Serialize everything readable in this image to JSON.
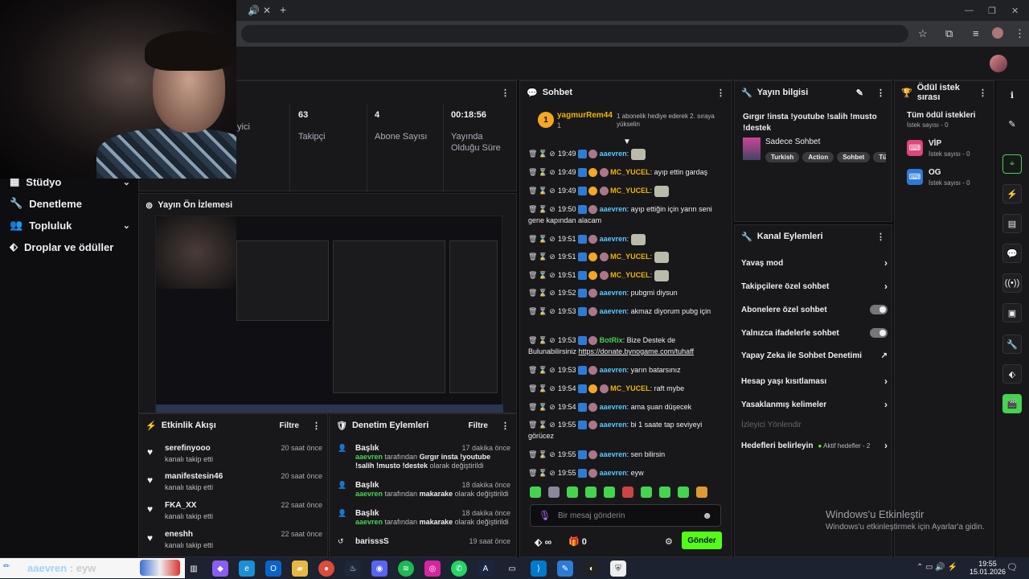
{
  "browser": {
    "tab_mute_icon": "speaker-icon",
    "tab_close": "✕",
    "new_tab": "+"
  },
  "sidebar": {
    "items": [
      {
        "label": "Stüdyo",
        "icon": "studio-icon",
        "chevron": true
      },
      {
        "label": "Denetleme",
        "icon": "wrench-icon",
        "chevron": false
      },
      {
        "label": "Topluluk",
        "icon": "community-icon",
        "chevron": true
      },
      {
        "label": "Droplar ve ödüller",
        "icon": "drops-icon",
        "chevron": false
      }
    ]
  },
  "stats": {
    "partial_label": "yici",
    "items": [
      {
        "value": "63",
        "label": "Takipçi"
      },
      {
        "value": "4",
        "label": "Abone Sayısı"
      },
      {
        "value": "00:18:56",
        "label": "Yayında Olduğu Süre"
      }
    ]
  },
  "preview": {
    "title": "Yayın Ön İzlemesi"
  },
  "events": {
    "title": "Etkinlik Akışı",
    "filter": "Filtre",
    "items": [
      {
        "name": "serefinyooo",
        "sub": "kanalı takip etti",
        "time": "20 saat önce"
      },
      {
        "name": "manifestesin46",
        "sub": "kanalı takip etti",
        "time": "20 saat önce"
      },
      {
        "name": "FKA_XX",
        "sub": "kanalı takip etti",
        "time": "22 saat önce"
      },
      {
        "name": "eneshh",
        "sub": "kanalı takip etti",
        "time": "22 saat önce"
      }
    ]
  },
  "moderation": {
    "title": "Denetim Eylemleri",
    "filter": "Filtre",
    "items": [
      {
        "head": "Başlık",
        "time": "17 dakika önce",
        "user": "aaevren",
        "mid": " tarafından ",
        "bold": "Gırgır insta !youtube !salih !musto !destek",
        "tail": " olarak değiştirildi"
      },
      {
        "head": "Başlık",
        "time": "18 dakika önce",
        "user": "aaevren",
        "mid": " tarafından ",
        "bold": "makarake",
        "tail": " olarak değiştirildi"
      },
      {
        "head": "Başlık",
        "time": "18 dakika önce",
        "user": "aaevren",
        "mid": " tarafından ",
        "bold": "makarake",
        "tail": " olarak değiştirildi"
      },
      {
        "head": "barisssS",
        "time": "19 saat önce",
        "user": "",
        "mid": "",
        "bold": "",
        "tail": ""
      }
    ]
  },
  "chat": {
    "title": "Sohbet",
    "pinned": {
      "user": "yagmurRem44",
      "count": "1",
      "text": "1 abonelik hediye ederek 2. sıraya yükselin"
    },
    "messages": [
      {
        "time": "19:49",
        "user": "aaevren",
        "cls": "u1",
        "gold": false,
        "text": "",
        "emote": true
      },
      {
        "time": "19:49",
        "user": "MC_YUCEL",
        "cls": "u2",
        "gold": true,
        "text": "ayıp ettin gardaş",
        "emote": false
      },
      {
        "time": "19:49",
        "user": "MC_YUCEL",
        "cls": "u2",
        "gold": true,
        "text": "",
        "emote": true
      },
      {
        "time": "19:50",
        "user": "aaevren",
        "cls": "u1",
        "gold": false,
        "text": "ayıp ettiğin için yarın seni gene kapından alacam",
        "emote": false
      },
      {
        "time": "19:51",
        "user": "aaevren",
        "cls": "u1",
        "gold": false,
        "text": "",
        "emote": true
      },
      {
        "time": "19:51",
        "user": "MC_YUCEL",
        "cls": "u2",
        "gold": true,
        "text": "",
        "emote": true
      },
      {
        "time": "19:51",
        "user": "MC_YUCEL",
        "cls": "u2",
        "gold": true,
        "text": "",
        "emote": true
      },
      {
        "time": "19:52",
        "user": "aaevren",
        "cls": "u1",
        "gold": false,
        "text": "pubgmi diysun",
        "emote": false
      },
      {
        "time": "19:53",
        "user": "aaevren",
        "cls": "u1",
        "gold": false,
        "text": "akmaz diyorum pubg için",
        "emote": false
      },
      {
        "time": "19:53",
        "user": "BotRix",
        "cls": "u3",
        "gold": false,
        "text": "Bize Destek de Bulunabilirsiniz ",
        "link": "https://donate.bynogame.com/tuhaff",
        "emote": false
      },
      {
        "time": "19:53",
        "user": "aaevren",
        "cls": "u1",
        "gold": false,
        "text": "yarın batarsınız",
        "emote": false
      },
      {
        "time": "19:54",
        "user": "MC_YUCEL",
        "cls": "u2",
        "gold": true,
        "text": "raft mybe",
        "emote": false
      },
      {
        "time": "19:54",
        "user": "aaevren",
        "cls": "u1",
        "gold": false,
        "text": "ama şuan düşecek",
        "emote": false
      },
      {
        "time": "19:55",
        "user": "aaevren",
        "cls": "u1",
        "gold": false,
        "text": "bi 1 saate tap seviyeyi görücez",
        "emote": false
      },
      {
        "time": "19:55",
        "user": "aaevren",
        "cls": "u1",
        "gold": false,
        "text": "sen bilirsin",
        "emote": false
      },
      {
        "time": "19:55",
        "user": "aaevren",
        "cls": "u1",
        "gold": false,
        "text": "eyw",
        "emote": false
      }
    ],
    "input_placeholder": "Bir mesaj gönderin",
    "infinity": "∞",
    "gift_count": "0",
    "send": "Gönder"
  },
  "stream_info": {
    "title": "Yayın bilgisi",
    "stream_title": "Gırgır !insta !youtube !salih !musto !destek",
    "category": "Sadece Sohbet",
    "tags": [
      "Turkish",
      "Action",
      "Sohbet",
      "Tür"
    ]
  },
  "rewards": {
    "title": "Ödül istek sırası",
    "all": "Tüm ödül istekleri",
    "all_count": "İstek sayısı - 0",
    "items": [
      {
        "name": "VİP",
        "count": "İstek sayısı - 0",
        "color": "#e0457b"
      },
      {
        "name": "OG",
        "count": "İstek sayısı - 0",
        "color": "#2e7bd6"
      }
    ]
  },
  "channel_actions": {
    "title": "Kanal Eylemleri",
    "rows": [
      {
        "label": "Yavaş mod",
        "type": "arrow"
      },
      {
        "label": "Takipçilere özel sohbet",
        "type": "arrow"
      },
      {
        "label": "Abonelere özel sohbet",
        "type": "toggle"
      },
      {
        "label": "Yalnızca ifadelerle sohbet",
        "type": "toggle"
      },
      {
        "label": "Yapay Zeka ile Sohbet Denetimi",
        "type": "ext"
      },
      {
        "label": "Hesap yaşı kısıtlaması",
        "type": "arrow"
      },
      {
        "label": "Yasaklanmış kelimeler",
        "type": "arrow"
      }
    ],
    "section": "İzleyici Yönlendir",
    "goals": {
      "label": "Hedefleri belirleyin",
      "status": "Aktif hedefler - 2"
    }
  },
  "watermark": {
    "title": "Windows'u Etkinleştir",
    "sub": "Windows'u etkinleştirmek için Ayarlar'a gidin."
  },
  "taskbar": {
    "overlay_user": "aaevren",
    "overlay_text": " : eyw",
    "time": "19:55",
    "date": "15.01.2026"
  }
}
